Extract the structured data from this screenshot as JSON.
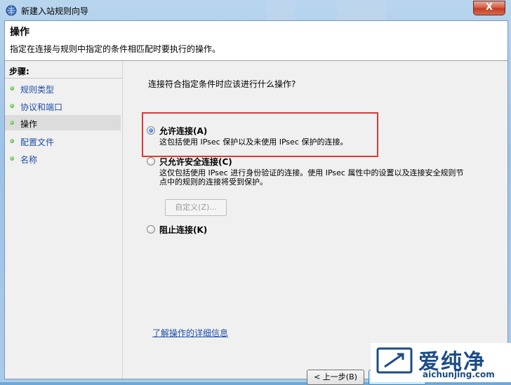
{
  "window": {
    "title": "新建入站规则向导",
    "close_label": "X"
  },
  "header": {
    "title": "操作",
    "description": "指定在连接与规则中指定的条件相匹配时要执行的操作。"
  },
  "sidebar": {
    "steps_label": "步骤:",
    "items": [
      {
        "label": "规则类型"
      },
      {
        "label": "协议和端口"
      },
      {
        "label": "操作"
      },
      {
        "label": "配置文件"
      },
      {
        "label": "名称"
      }
    ]
  },
  "main": {
    "question": "连接符合指定条件时应该进行什么操作?",
    "options": [
      {
        "label": "允许连接(A)",
        "description": "这包括使用 IPsec 保护以及未使用 IPsec 保护的连接。",
        "selected": true
      },
      {
        "label": "只允许安全连接(C)",
        "description": "这仅包括使用 IPsec 进行身份验证的连接。使用 IPsec 属性中的设置以及连接安全规则节点中的规则的连接将受到保护。",
        "selected": false
      },
      {
        "label": "阻止连接(K)",
        "description": "",
        "selected": false
      }
    ],
    "customize_button": "自定义(Z)...",
    "help_link": "了解操作的详细信息"
  },
  "footer": {
    "back_button": "< 上一步(B)"
  },
  "watermark": {
    "brand": "爱纯净",
    "url": "aichunjing.com"
  },
  "colors": {
    "highlight_border": "#d83a3a",
    "link": "#1f4ea8",
    "step_dot": "#3aa12e"
  }
}
